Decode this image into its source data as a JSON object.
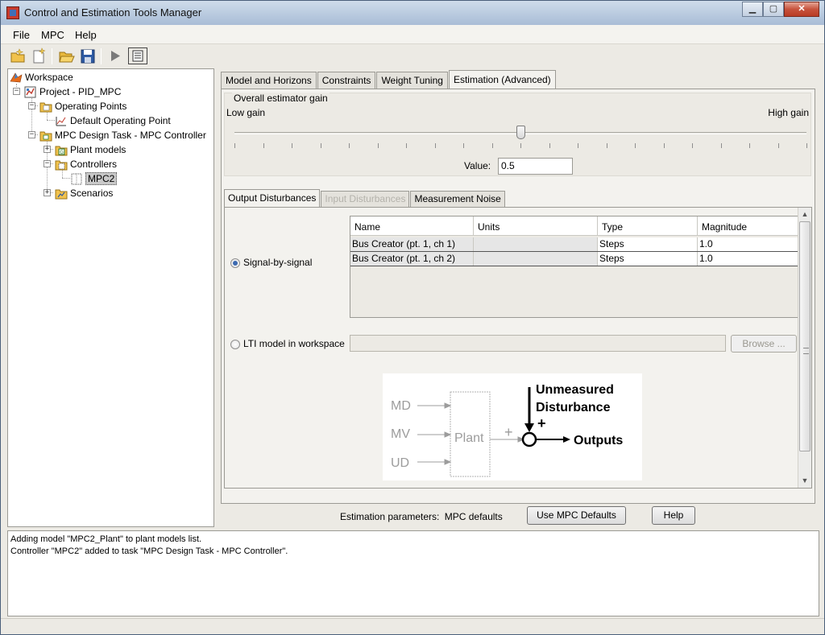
{
  "window": {
    "title": "Control and Estimation Tools Manager"
  },
  "menu": {
    "file": "File",
    "mpc": "MPC",
    "help": "Help"
  },
  "toolbar": {
    "icons": [
      "new-project-icon",
      "new-task-icon",
      "open-icon",
      "save-icon",
      "run-icon",
      "notes-icon"
    ]
  },
  "tree": {
    "workspace": "Workspace",
    "project": "Project - PID_MPC",
    "operating_points": "Operating Points",
    "default_operating_point": "Default Operating Point",
    "mpc_task": "MPC Design Task - MPC Controller",
    "plant_models": "Plant models",
    "controllers": "Controllers",
    "mpc2": "MPC2",
    "scenarios": "Scenarios"
  },
  "tabs": {
    "model_horizons": "Model and Horizons",
    "constraints": "Constraints",
    "weight_tuning": "Weight Tuning",
    "estimation": "Estimation (Advanced)",
    "active": "estimation"
  },
  "gain": {
    "group_label": "Overall estimator gain",
    "low": "Low gain",
    "high": "High gain",
    "value_label": "Value:",
    "value": "0.5",
    "slider_fraction": 0.5
  },
  "subtabs": {
    "output": "Output Disturbances",
    "input": "Input Disturbances",
    "noise": "Measurement Noise",
    "active": "output"
  },
  "disturbance": {
    "signal_option": "Signal-by-signal",
    "signal_selected": true,
    "lti_option": "LTI model in workspace",
    "lti_value": "",
    "browse": "Browse ...",
    "columns": [
      "Name",
      "Units",
      "Type",
      "Magnitude"
    ],
    "rows": [
      {
        "name": "Bus Creator (pt. 1, ch 1)",
        "units": "",
        "type": "Steps",
        "magnitude": "1.0"
      },
      {
        "name": "Bus Creator (pt. 1, ch 2)",
        "units": "",
        "type": "Steps",
        "magnitude": "1.0"
      }
    ]
  },
  "diagram": {
    "md": "MD",
    "mv": "MV",
    "ud": "UD",
    "plant": "Plant",
    "plus_left": "+",
    "plus_top": "+",
    "unmeasured": "Unmeasured",
    "disturbance": "Disturbance",
    "outputs": "Outputs"
  },
  "bottom": {
    "est_label": "Estimation parameters:",
    "est_value": "MPC defaults",
    "use_defaults": "Use MPC Defaults",
    "help": "Help"
  },
  "log": {
    "lines": [
      "Adding model \"MPC2_Plant\" to plant models list.",
      "Controller \"MPC2\" added to task \"MPC Design Task - MPC Controller\"."
    ]
  },
  "colors": {
    "title_bar": "#b7c9de",
    "close_button": "#c7523c",
    "radio_dot": "#3c6ab0",
    "panel_bg": "#eceae4"
  }
}
